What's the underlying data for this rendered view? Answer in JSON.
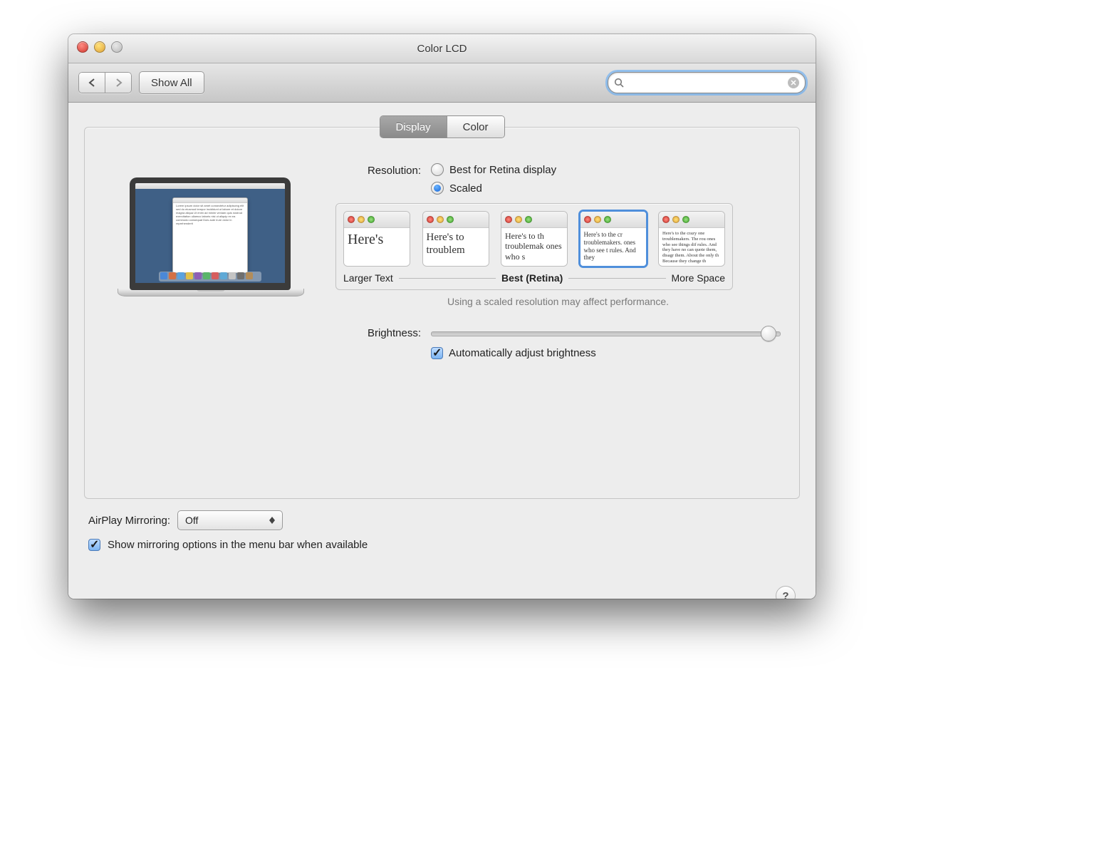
{
  "window": {
    "title": "Color LCD"
  },
  "toolbar": {
    "show_all": "Show All",
    "search_placeholder": ""
  },
  "tabs": {
    "display": "Display",
    "color": "Color"
  },
  "resolution": {
    "label": "Resolution:",
    "best": "Best for Retina display",
    "scaled": "Scaled",
    "labels": {
      "left": "Larger Text",
      "center": "Best (Retina)",
      "right": "More Space"
    },
    "note": "Using a scaled resolution may affect performance.",
    "thumbs": [
      "Here's",
      "Here's to troublem",
      "Here's to th troublemak ones who s",
      "Here's to the cr troublemakers. ones who see t rules. And they",
      "Here's to the crazy one troublemakers. The rou ones who see things dif rules. And they have no can quote them, disagr them. About the only th Because they change th"
    ]
  },
  "brightness": {
    "label": "Brightness:",
    "auto": "Automatically adjust brightness"
  },
  "airplay": {
    "label": "AirPlay Mirroring:",
    "value": "Off"
  },
  "mirroring_checkbox": "Show mirroring options in the menu bar when available"
}
